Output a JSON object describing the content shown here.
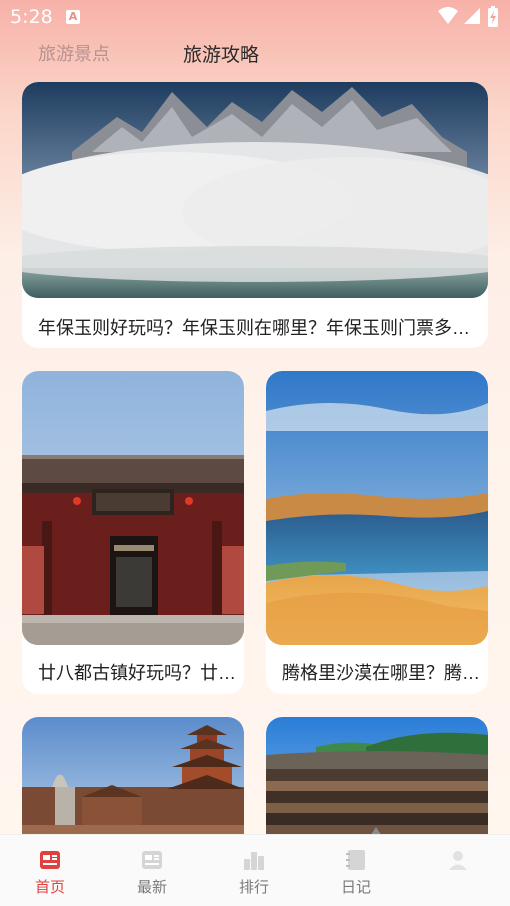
{
  "status_bar": {
    "time": "5:28"
  },
  "tabs": [
    {
      "label": "旅游景点"
    },
    {
      "label": "旅游攻略"
    }
  ],
  "cards": [
    {
      "title": "年保玉则好玩吗？年保玉则在哪里？年保玉则门票多少钱？"
    },
    {
      "title": "廿八都古镇好玩吗？廿八都古镇在哪里？"
    },
    {
      "title": "腾格里沙漠在哪里？腾格里沙漠好玩吗？"
    },
    {
      "title": ""
    },
    {
      "title": ""
    }
  ],
  "bottom_nav": [
    {
      "label": "首页",
      "icon": "news-icon"
    },
    {
      "label": "最新",
      "icon": "article-icon"
    },
    {
      "label": "排行",
      "icon": "ranking-icon"
    },
    {
      "label": "日记",
      "icon": "notebook-icon"
    },
    {
      "label": "",
      "icon": "profile-icon"
    }
  ],
  "colors": {
    "accent": "#e0413f",
    "inactive": "#7a7a7a"
  }
}
